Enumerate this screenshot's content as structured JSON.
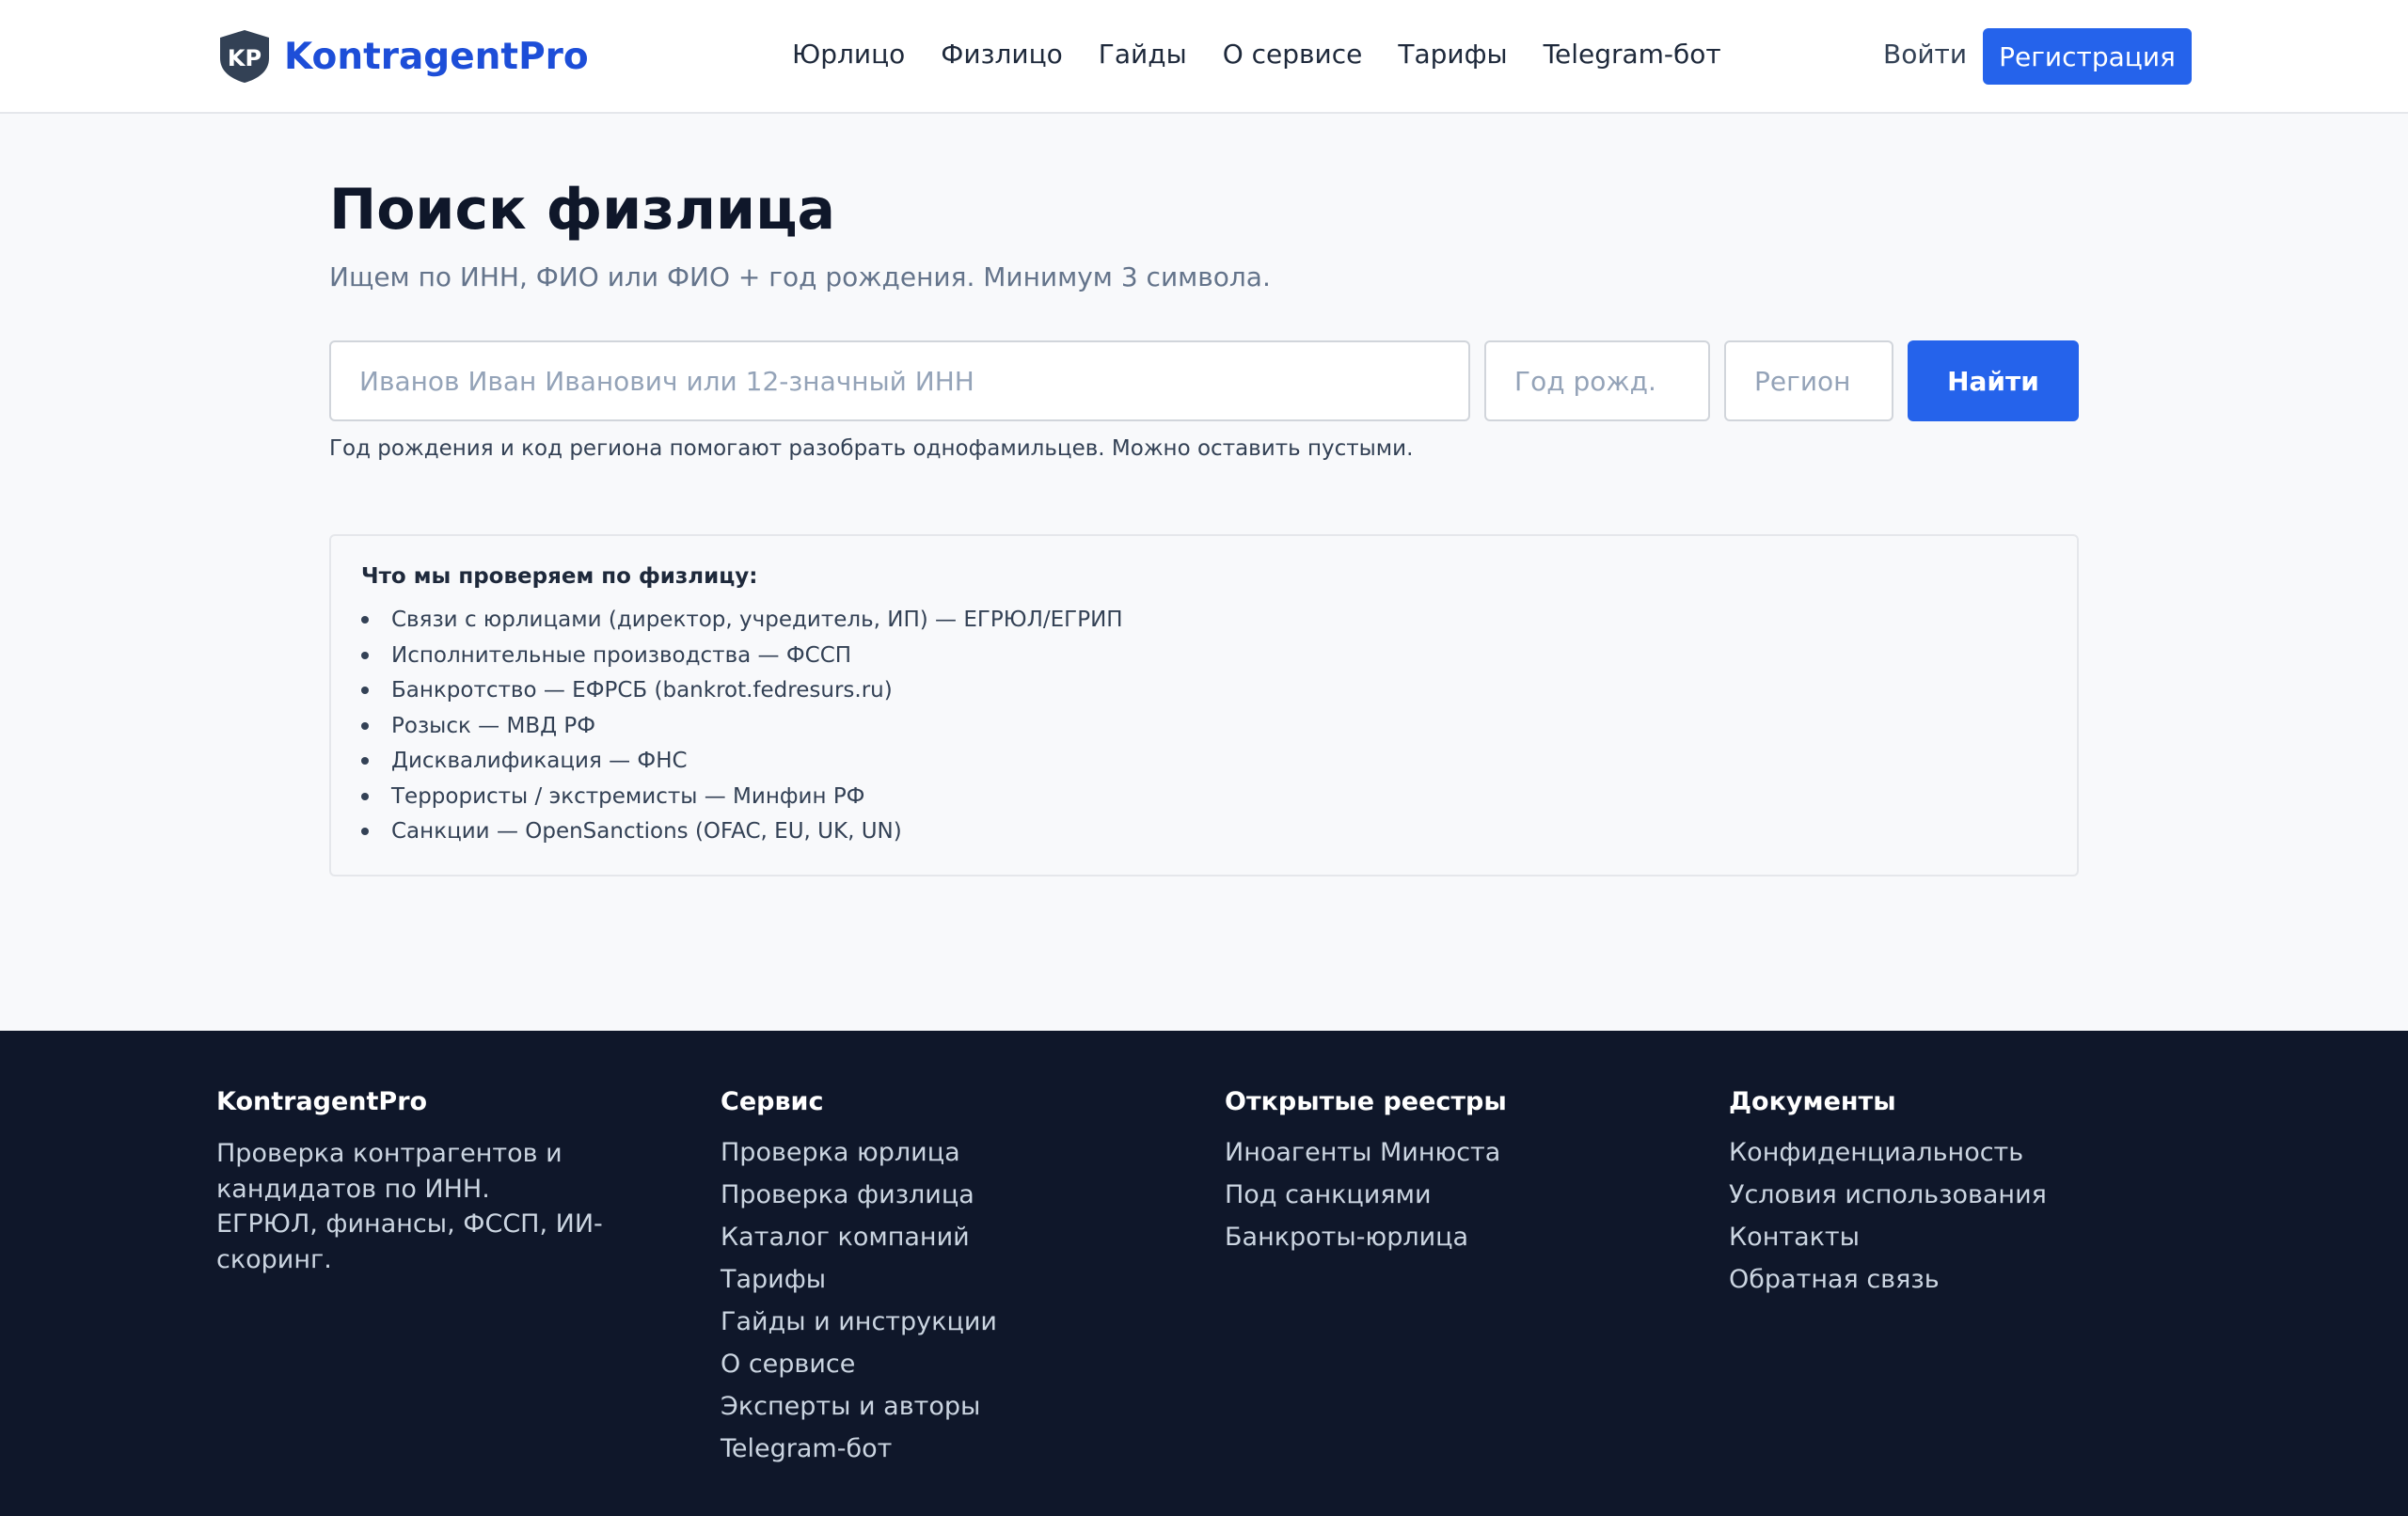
{
  "header": {
    "logo_text": "KontragentPro",
    "logo_mark": "KP",
    "nav": [
      "Юрлицо",
      "Физлицо",
      "Гайды",
      "О сервисе",
      "Тарифы",
      "Telegram-бот"
    ],
    "login_label": "Войти",
    "register_label": "Регистрация"
  },
  "main": {
    "title": "Поиск физлица",
    "subtitle": "Ищем по ИНН, ФИО или ФИО + год рождения. Минимум 3 символа.",
    "search": {
      "name_placeholder": "Иванов Иван Иванович или 12-значный ИНН",
      "year_placeholder": "Год рожд.",
      "region_placeholder": "Регион",
      "button_label": "Найти"
    },
    "hint": "Год рождения и код региона помогают разобрать однофамильцев. Можно оставить пустыми.",
    "checks": {
      "title": "Что мы проверяем по физлицу:",
      "items": [
        "Связи с юрлицами (директор, учредитель, ИП) — ЕГРЮЛ/ЕГРИП",
        "Исполнительные производства — ФССП",
        "Банкротство — ЕФРСБ (bankrot.fedresurs.ru)",
        "Розыск — МВД РФ",
        "Дисквалификация — ФНС",
        "Террористы / экстремисты — Минфин РФ",
        "Санкции — OpenSanctions (OFAC, EU, UK, UN)"
      ]
    }
  },
  "footer": {
    "col1": {
      "title": "KontragentPro",
      "desc_line1": "Проверка контрагентов и кандидатов по ИНН.",
      "desc_line2": "ЕГРЮЛ, финансы, ФССП, ИИ-скоринг."
    },
    "col2": {
      "title": "Сервис",
      "links": [
        "Проверка юрлица",
        "Проверка физлица",
        "Каталог компаний",
        "Тарифы",
        "Гайды и инструкции",
        "О сервисе",
        "Эксперты и авторы",
        "Telegram-бот"
      ]
    },
    "col3": {
      "title": "Открытые реестры",
      "links": [
        "Иноагенты Минюста",
        "Под санкциями",
        "Банкроты-юрлица"
      ]
    },
    "col4": {
      "title": "Документы",
      "links": [
        "Конфиденциальность",
        "Условия использования",
        "Контакты",
        "Обратная связь"
      ]
    }
  },
  "colors": {
    "accent": "#2563eb",
    "brand": "#1d4ed8",
    "footer_bg": "#0f172a",
    "page_bg": "#f8f9fb"
  }
}
